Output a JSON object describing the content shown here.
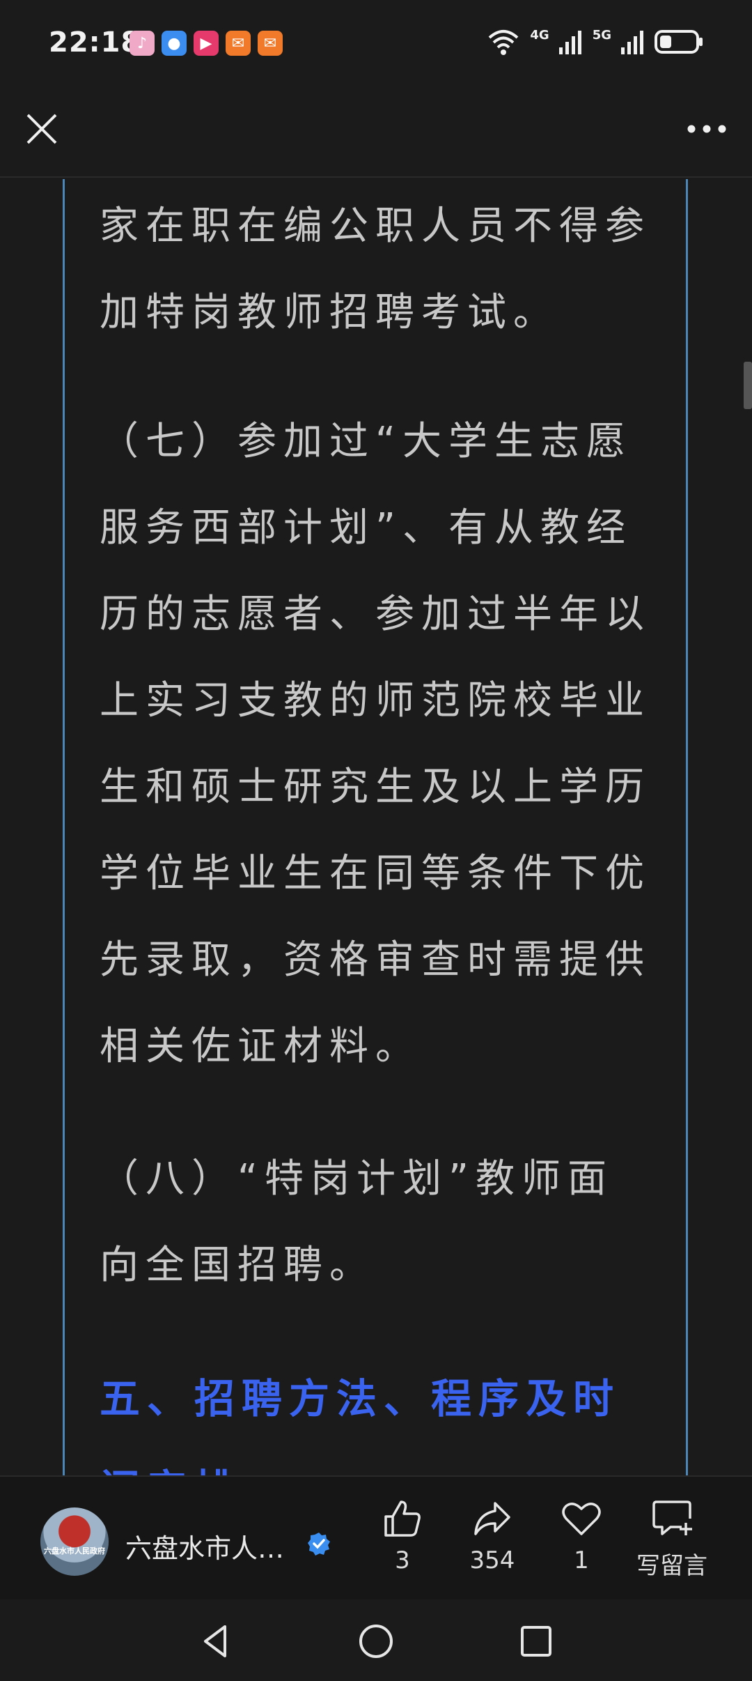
{
  "status_bar": {
    "time": "22:18",
    "network_1": "4G",
    "network_2": "5G",
    "app_icons": [
      "music-app-icon",
      "browser-app-icon",
      "video-app-icon",
      "red-envelope-app-icon",
      "red-envelope-app-icon-2"
    ]
  },
  "top_bar": {
    "close_icon": "close-icon",
    "more_icon": "more-icon"
  },
  "article": {
    "paragraph_1": "家在职在编公职人员不得参加特岗教师招聘考试。",
    "paragraph_2": "（七）参加过“大学生志愿服务西部计划”、有从教经历的志愿者、参加过半年以上实习支教的师范院校毕业生和硕士研究生及以上学历学位毕业生在同等条件下优先录取，资格审查时需提供相关佐证材料。",
    "paragraph_3": "（八）“特岗计划”教师面向全国招聘。",
    "heading": "五、招聘方法、程序及时间安排",
    "frame_color": "#4a86b8",
    "heading_color": "#3a63f0"
  },
  "action_bar": {
    "author_name": "六盘水市人…",
    "avatar_text": "六盘水市人民政府",
    "like_count": "3",
    "share_count": "354",
    "favorite_count": "1",
    "comment_label": "写留言",
    "verified_color": "#3a8ef0"
  },
  "nav_bar": {
    "icons": [
      "back-icon",
      "home-icon",
      "recent-apps-icon"
    ]
  }
}
